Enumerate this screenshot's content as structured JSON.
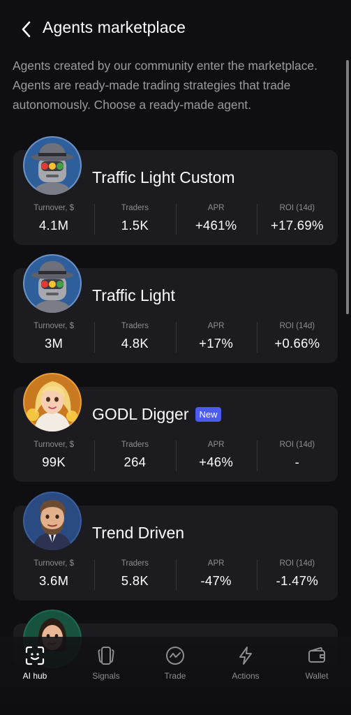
{
  "header": {
    "title": "Agents marketplace"
  },
  "description": "Agents created by our community enter the marketplace. Agents are ready-made trading strategies that trade autonomously. Choose a ready-made agent.",
  "stat_labels": {
    "turnover": "Turnover, $",
    "traders": "Traders",
    "apr": "APR",
    "roi": "ROI (14d)"
  },
  "agents": [
    {
      "name": "Traffic Light Custom",
      "badge": "",
      "turnover": "4.1M",
      "traders": "1.5K",
      "apr": "+461%",
      "roi": "+17.69%",
      "avatar_icon": "robot-detective-avatar-icon"
    },
    {
      "name": "Traffic Light",
      "badge": "",
      "turnover": "3M",
      "traders": "4.8K",
      "apr": "+17%",
      "roi": "+0.66%",
      "avatar_icon": "robot-detective-avatar-icon"
    },
    {
      "name": "GODL Digger",
      "badge": "New",
      "turnover": "99K",
      "traders": "264",
      "apr": "+46%",
      "roi": "-",
      "avatar_icon": "blonde-woman-avatar-icon"
    },
    {
      "name": "Trend Driven",
      "badge": "",
      "turnover": "3.6M",
      "traders": "5.8K",
      "apr": "-47%",
      "roi": "-1.47%",
      "avatar_icon": "bearded-man-avatar-icon"
    }
  ],
  "tabs": [
    {
      "label": "AI hub",
      "icon": "face-scan-icon",
      "active": true
    },
    {
      "label": "Signals",
      "icon": "cards-icon",
      "active": false
    },
    {
      "label": "Trade",
      "icon": "chart-circle-icon",
      "active": false
    },
    {
      "label": "Actions",
      "icon": "lightning-icon",
      "active": false
    },
    {
      "label": "Wallet",
      "icon": "wallet-icon",
      "active": false
    }
  ],
  "colors": {
    "background": "#0f0f12",
    "card": "#1b1b20",
    "badge": "#4d5cf0",
    "muted_text": "#8d8d93"
  }
}
